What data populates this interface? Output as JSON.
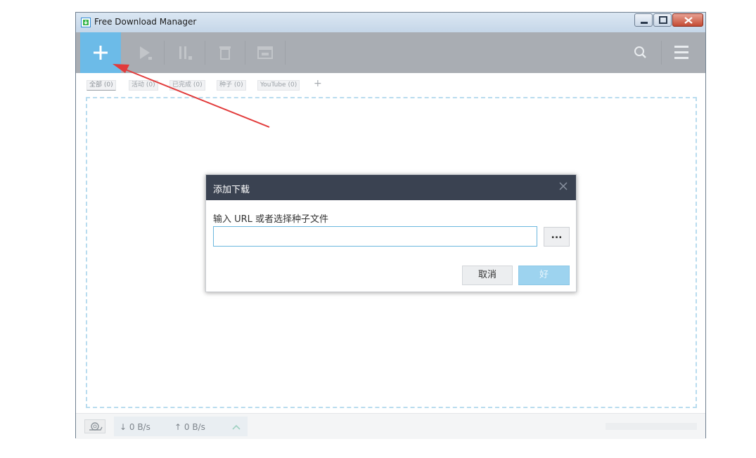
{
  "window": {
    "title": "Free Download Manager"
  },
  "toolbar": {
    "add": {
      "icon": "plus-icon"
    },
    "buttons": [
      {
        "name": "resume",
        "icon": "play-icon"
      },
      {
        "name": "pause",
        "icon": "pause-icon"
      },
      {
        "name": "delete",
        "icon": "trash-icon"
      },
      {
        "name": "folder",
        "icon": "folder-icon"
      }
    ],
    "search_icon": "search-icon",
    "menu_icon": "hamburger-menu-icon"
  },
  "filters": [
    {
      "label": "全部 (0)",
      "active": true
    },
    {
      "label": "活动 (0)",
      "active": false
    },
    {
      "label": "已完成 (0)",
      "active": false
    },
    {
      "label": "种子 (0)",
      "active": false
    },
    {
      "label": "YouTube (0)",
      "active": false
    }
  ],
  "statusbar": {
    "snail_icon": "snail-icon",
    "download_speed": "↓ 0 B/s",
    "upload_speed": "↑ 0 B/s",
    "expand_icon": "chevron-up-icon"
  },
  "dialog": {
    "title": "添加下载",
    "label": "输入 URL 或者选择种子文件",
    "input_value": "",
    "browse_label": "...",
    "cancel_label": "取消",
    "ok_label": "好"
  },
  "colors": {
    "accent": "#6cbbe8",
    "toolbar_bg": "#a9adb3",
    "dialog_header": "#3a4251",
    "annotation_arrow": "#e23b3b"
  }
}
